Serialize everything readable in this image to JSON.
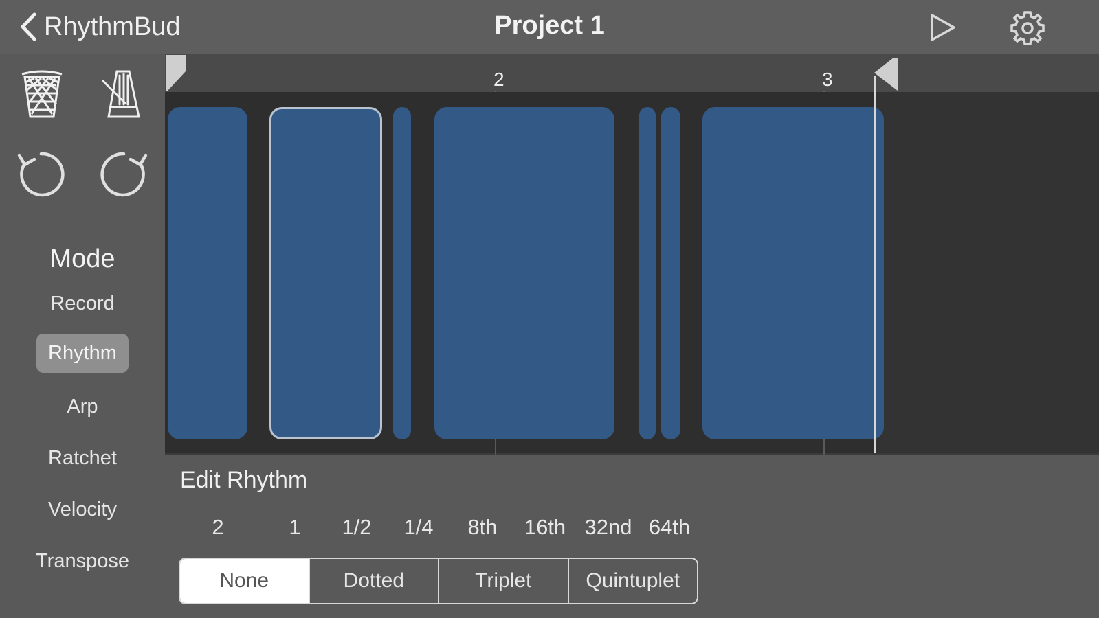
{
  "nav": {
    "back_label": "RhythmBud",
    "title": "Project 1",
    "back_icon": "chevron-left-icon",
    "play_icon": "play-icon",
    "settings_icon": "gear-icon"
  },
  "tools": {
    "clear_icon": "trash-icon",
    "metronome_icon": "metronome-icon",
    "undo_icon": "undo-icon",
    "redo_icon": "redo-icon"
  },
  "mode": {
    "title": "Mode",
    "items": [
      "Record",
      "Rhythm",
      "Arp",
      "Ratchet",
      "Velocity",
      "Transpose"
    ],
    "selected": "Rhythm"
  },
  "timeline": {
    "bar_labels": [
      "2",
      "3"
    ],
    "note_count": 7,
    "selected_note_index": 2
  },
  "edit": {
    "title": "Edit Rhythm",
    "durations": [
      "2",
      "1",
      "1/2",
      "1/4",
      "8th",
      "16th",
      "32nd",
      "64th"
    ],
    "modifiers": [
      "None",
      "Dotted",
      "Triplet",
      "Quintuplet"
    ],
    "selected_modifier": "None"
  },
  "colors": {
    "note_fill": "#335a86",
    "selected_outline": "#b9c4d0",
    "topbar": "#5e5e5e",
    "sidebar": "#595959"
  }
}
